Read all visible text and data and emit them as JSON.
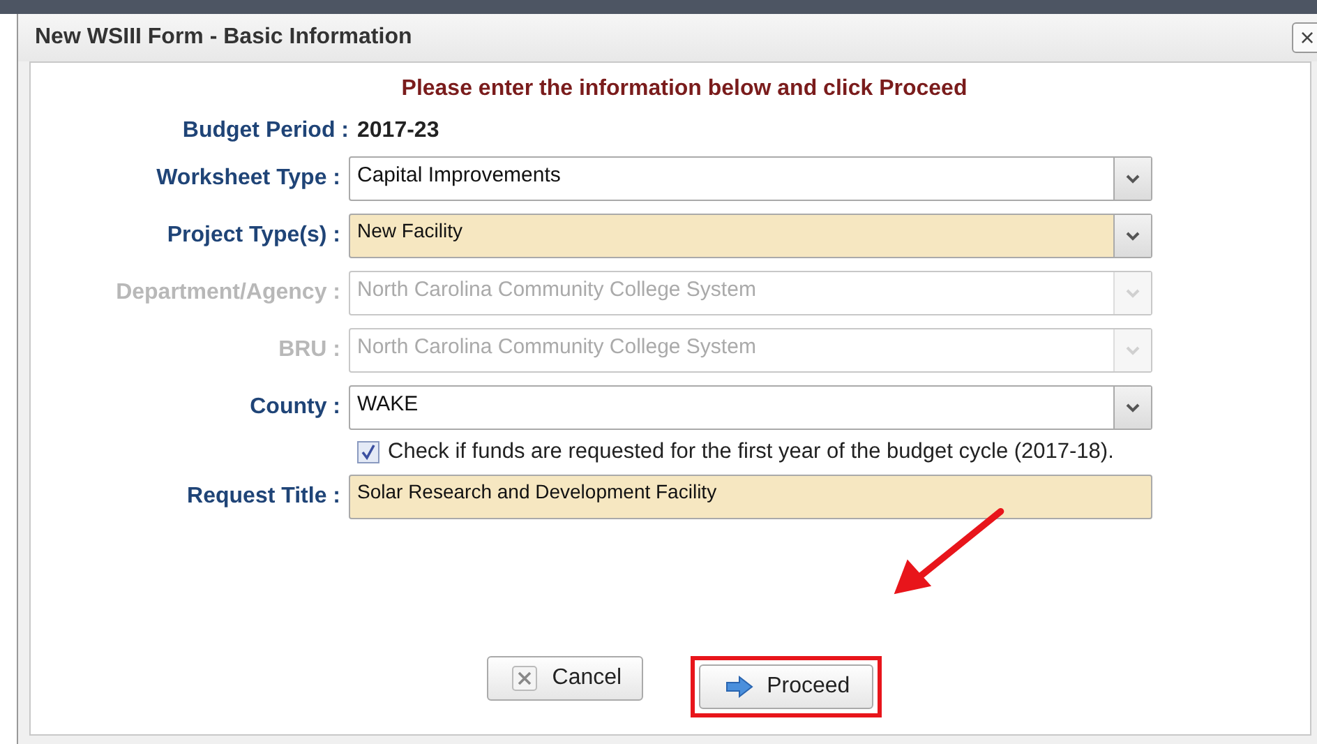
{
  "dialog": {
    "title": "New WSIII Form - Basic Information",
    "close": "×"
  },
  "instruction": "Please enter the information below and click Proceed",
  "fields": [
    {
      "kind": "static",
      "label": "Budget Period :",
      "value": "2017-23"
    },
    {
      "kind": "select",
      "label": "Worksheet Type :",
      "value": "Capital Improvements",
      "disabled": false,
      "required": false
    },
    {
      "kind": "select",
      "label": "Project Type(s) :",
      "value": "New Facility",
      "disabled": false,
      "required": true
    },
    {
      "kind": "select",
      "label": "Department/Agency :",
      "value": "North Carolina Community College System",
      "disabled": true,
      "required": false
    },
    {
      "kind": "select",
      "label": "BRU :",
      "value": "North Carolina Community College System",
      "disabled": true,
      "required": false
    },
    {
      "kind": "select",
      "label": "County :",
      "value": "WAKE",
      "disabled": false,
      "required": false
    },
    {
      "kind": "checkbox",
      "label": "Check if funds are requested for the first year of the budget cycle (2017-18).",
      "checked": true
    },
    {
      "kind": "text",
      "label": "Request Title :",
      "value": "Solar Research and Development Facility",
      "disabled": false,
      "required": true
    }
  ],
  "buttons": [
    {
      "kind": "cancel",
      "label": "Cancel",
      "annotated": false
    },
    {
      "kind": "proceed",
      "label": "Proceed",
      "annotated": true
    }
  ]
}
